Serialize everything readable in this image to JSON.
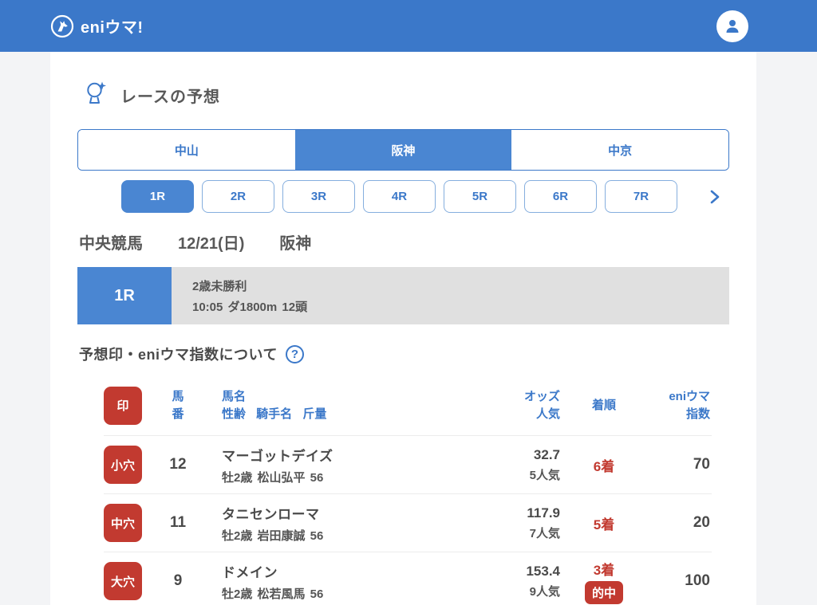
{
  "colors": {
    "header_blue": "#3b78c9",
    "accent_blue": "#4a86d2",
    "text_blue": "#3b78c9",
    "badge_red": "#c23a30",
    "banner_gray": "#e0e0e0",
    "page_gray": "#f3f4f6"
  },
  "icons": {
    "logo": "horse-icon",
    "avatar": "user-icon",
    "title": "crystal-ball-icon",
    "help": "question-icon",
    "help_glyph": "?",
    "next": "chevron-right-icon"
  },
  "header": {
    "logo_text": "eniウマ!"
  },
  "page": {
    "title": "レースの予想"
  },
  "venue_tabs": [
    {
      "label": "中山",
      "selected": false
    },
    {
      "label": "阪神",
      "selected": true
    },
    {
      "label": "中京",
      "selected": false
    }
  ],
  "race_tabs": [
    {
      "label": "1R",
      "selected": true
    },
    {
      "label": "2R",
      "selected": false
    },
    {
      "label": "3R",
      "selected": false
    },
    {
      "label": "4R",
      "selected": false
    },
    {
      "label": "5R",
      "selected": false
    },
    {
      "label": "6R",
      "selected": false
    },
    {
      "label": "7R",
      "selected": false
    }
  ],
  "race_meta": {
    "category": "中央競馬",
    "date": "12/21(日)",
    "venue": "阪神"
  },
  "race_banner": {
    "race_no": "1R",
    "line1": "2歳未勝利",
    "line2": "10:05 ダ1800m 12頭"
  },
  "section": {
    "title": "予想印・eniウマ指数について"
  },
  "table": {
    "headers": {
      "mark": "印",
      "umaban_top": "馬",
      "umaban_bottom": "番",
      "name_top": "馬名",
      "name_bottom": "性齢 騎手名 斤量",
      "odds_top": "オッズ",
      "odds_bottom": "人気",
      "finish": "着順",
      "index_top": "eniウマ",
      "index_bottom": "指数"
    },
    "rows": [
      {
        "mark": "小穴",
        "umaban": "12",
        "name": "マーゴットデイズ",
        "detail": "牡2歳 松山弘平 56",
        "odds": "32.7",
        "popularity": "5人気",
        "finish": "6着",
        "index": "70"
      },
      {
        "mark": "中穴",
        "umaban": "11",
        "name": "タニセンローマ",
        "detail": "牡2歳 岩田康誠 56",
        "odds": "117.9",
        "popularity": "7人気",
        "finish": "5着",
        "index": "20"
      },
      {
        "mark": "大穴",
        "umaban": "9",
        "name": "ドメイン",
        "detail": "牡2歳 松若風馬 56",
        "odds": "153.4",
        "popularity": "9人気",
        "finish": "3着",
        "hit_label": "的中",
        "index": "100"
      }
    ]
  }
}
